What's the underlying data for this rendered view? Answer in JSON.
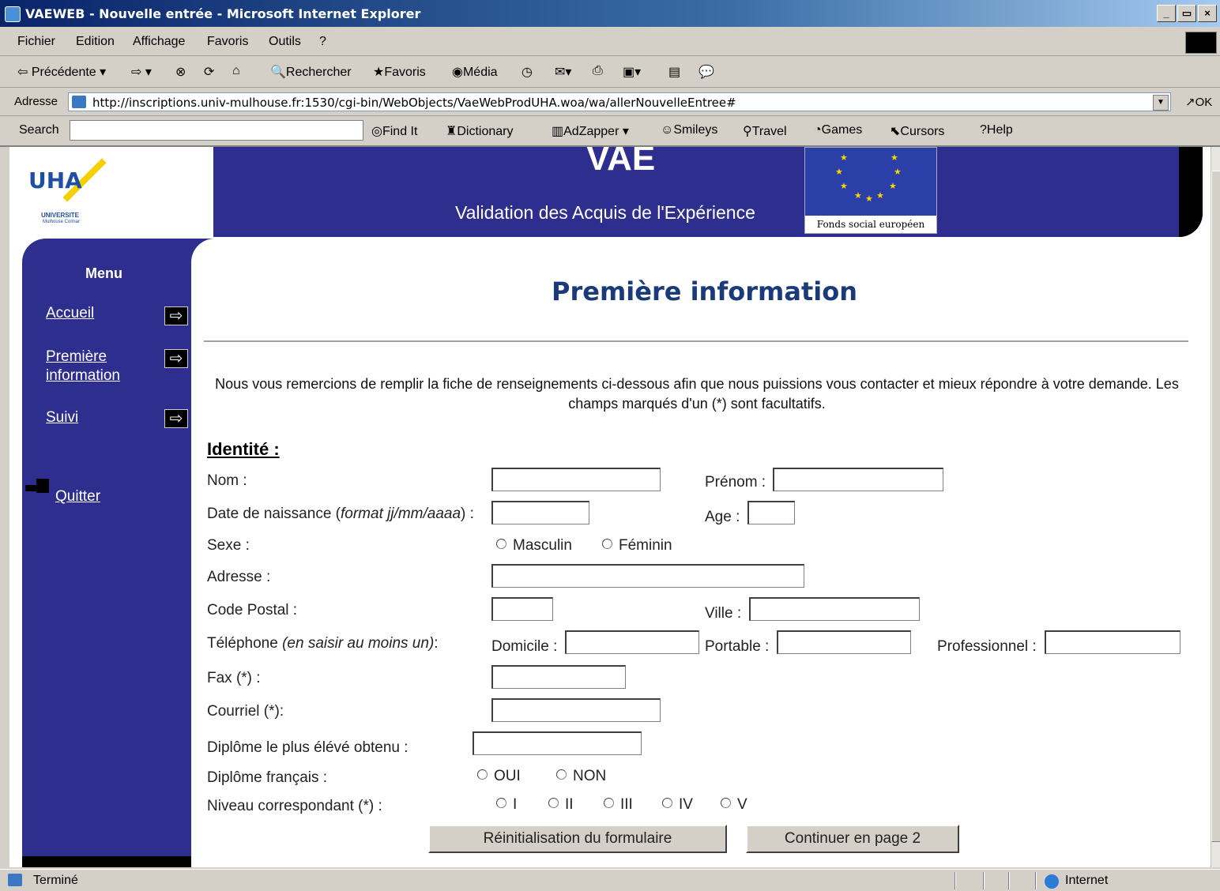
{
  "window": {
    "title": "VAEWEB - Nouvelle entrée - Microsoft Internet Explorer",
    "controls": [
      "_",
      "▭",
      "×"
    ]
  },
  "menubar": [
    "Fichier",
    "Edition",
    "Affichage",
    "Favoris",
    "Outils",
    "?"
  ],
  "toolbar": {
    "back": "Précédente",
    "search": "Rechercher",
    "favorites": "Favoris",
    "media": "Média"
  },
  "address": {
    "label": "Adresse",
    "url": "http://inscriptions.univ-mulhouse.fr:1530/cgi-bin/WebObjects/VaeWebProdUHA.woa/wa/allerNouvelleEntree#",
    "go": "OK"
  },
  "searchbar": {
    "label": "Search",
    "value": "",
    "buttons": [
      "Find It",
      "Dictionary",
      "AdZapper",
      "Smileys",
      "Travel",
      "Games",
      "Cursors",
      "Help"
    ]
  },
  "header": {
    "title": "VAE",
    "subtitle": "Validation des Acquis de l'Expérience",
    "eu_caption": "Fonds social européen",
    "logo_text": "UHA",
    "logo_univ": "UNIVERSITE",
    "logo_city": "Mulhouse Colmar"
  },
  "menu": {
    "title": "Menu",
    "items": [
      "Accueil",
      "Première information",
      "Suivi"
    ],
    "quit": "Quitter"
  },
  "page": {
    "title": "Première information",
    "intro": "Nous vous remercions de remplir la fiche de renseignements ci-dessous afin que nous puissions vous contacter et mieux répondre à votre demande. Les champs marqués d'un (*) sont facultatifs.",
    "section": "Identité :"
  },
  "form": {
    "nom": "Nom :",
    "prenom": "Prénom :",
    "date_naissance": "Date de naissance (",
    "date_format": "format jj/mm/aaaa",
    "date_end": ") :",
    "age": "Age :",
    "sexe": "Sexe :",
    "masculin": "Masculin",
    "feminin": "Féminin",
    "adresse": "Adresse :",
    "code_postal": "Code Postal :",
    "ville": "Ville :",
    "telephone": "Téléphone ",
    "telephone_hint": "(en saisir au moins un)",
    "telephone_end": ":",
    "domicile": "Domicile :",
    "portable": "Portable :",
    "professionnel": "Professionnel :",
    "fax": "Fax (*) :",
    "courriel": "Courriel (*):",
    "diplome": "Diplôme le plus élévé obtenu :",
    "diplome_francais": "Diplôme français :",
    "oui": "OUI",
    "non": "NON",
    "niveau": "Niveau correspondant (*) :",
    "niveaux": [
      "I",
      "II",
      "III",
      "IV",
      "V"
    ],
    "reset": "Réinitialisation du formulaire",
    "continue": "Continuer en page 2"
  },
  "status": {
    "text": "Terminé",
    "zone": "Internet"
  }
}
